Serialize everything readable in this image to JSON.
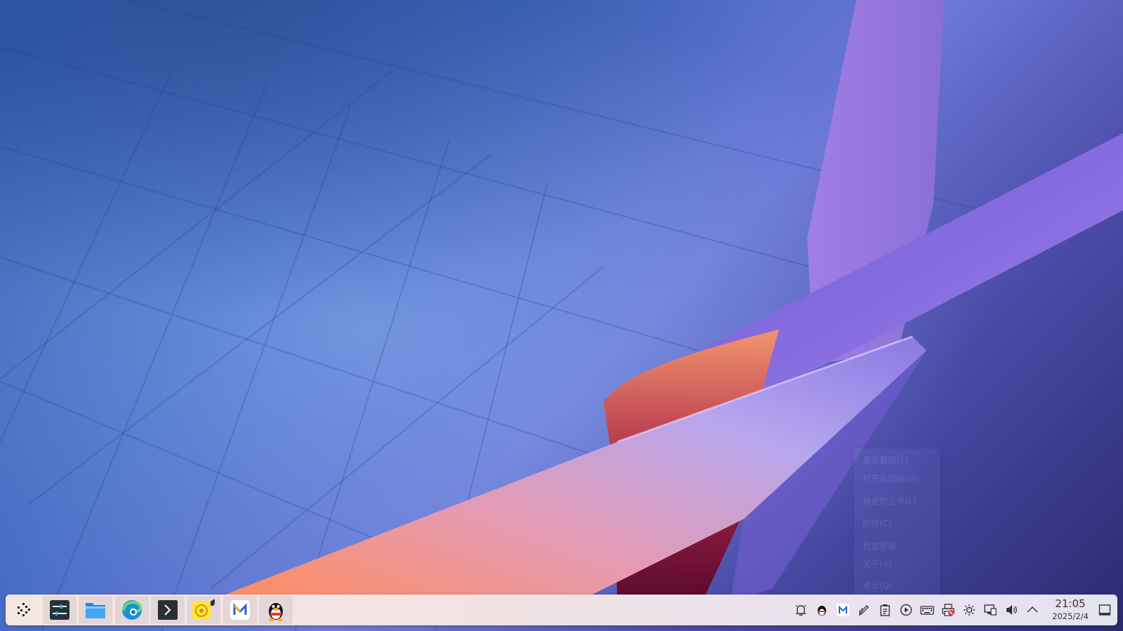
{
  "desktop": {
    "context_menu": {
      "items": [
        "显示截图(T)",
        "打开启动器(O)",
        "最近的上传(L)",
        "配置(C)",
        "检查更新",
        "关于(A)",
        "退出(Q)"
      ]
    }
  },
  "taskbar": {
    "apps": [
      {
        "name": "application-launcher",
        "icon": "kde-launcher-icon"
      },
      {
        "name": "system-settings",
        "icon": "settings-sliders-icon"
      },
      {
        "name": "file-manager",
        "icon": "folder-icon"
      },
      {
        "name": "microsoft-edge",
        "icon": "edge-browser-icon"
      },
      {
        "name": "terminal",
        "icon": "terminal-icon"
      },
      {
        "name": "music-player",
        "icon": "music-player-icon"
      },
      {
        "name": "mail-client",
        "icon": "mail-m-icon"
      },
      {
        "name": "qq",
        "icon": "qq-penguin-icon"
      }
    ],
    "tray": [
      "notifications-icon",
      "qq-tray-icon",
      "mail-tray-icon",
      "pen-tool-icon",
      "clipboard-icon",
      "media-player-icon",
      "keyboard-icon",
      "printer-icon",
      "brightness-icon",
      "network-icon",
      "volume-icon",
      "expand-arrow-icon"
    ],
    "clock": {
      "time": "21:05",
      "date": "2025/2/4"
    }
  }
}
